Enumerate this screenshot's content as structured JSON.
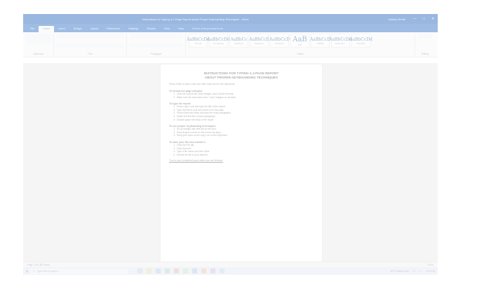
{
  "window": {
    "title": "Instructions for Typing a 2-Page Report about Proper Keyboarding Techniques - Word",
    "user": "Jessica Smith"
  },
  "menu": {
    "items": [
      "File",
      "Home",
      "Insert",
      "Design",
      "Layout",
      "References",
      "Mailings",
      "Review",
      "View",
      "Help"
    ],
    "active_index": 1,
    "tell_me": "Tell me what you want to do"
  },
  "ribbon": {
    "groups": [
      "Clipboard",
      "Font",
      "Paragraph",
      "Styles",
      "Editing"
    ],
    "styles": [
      {
        "sample": "AaBbCcDd",
        "name": "Normal"
      },
      {
        "sample": "AaBbCcDd",
        "name": "No Spacing"
      },
      {
        "sample": "AaBbCc",
        "name": "Heading 1"
      },
      {
        "sample": "AaBbCcE",
        "name": "Heading 2"
      },
      {
        "sample": "AaBbCcD",
        "name": "Heading 3"
      },
      {
        "sample": "AaB",
        "name": "Title"
      },
      {
        "sample": "AaBbCcD",
        "name": "Subtitle"
      },
      {
        "sample": "AaBbCcDd",
        "name": "Subtle Em..."
      },
      {
        "sample": "AaBbCcDd",
        "name": "Emphasis"
      }
    ]
  },
  "document": {
    "title_line1": "INSTRUCTIONS FOR TYPING A 2-PAGE REPORT",
    "title_line2": "ABOUT PROPER KEYBOARDING TECHNIQUES",
    "intro": "Press Enter to start a new line after each item in the directions.",
    "sections": [
      {
        "heading": "To format the page margins:",
        "items": [
          "Click the Layout tab, click Margins, and choose Normal.",
          "Make sure the document uses 1-inch margins on all sides."
        ]
      },
      {
        "heading": "To type the report:",
        "items": [
          "Press Caps Lock and type the title of the report.",
          "Type the title in bold and center it on the page.",
          "Press Enter two times and type the body paragraphs.",
          "Indent the first line of each paragraph.",
          "Double space the body of the report."
        ]
      },
      {
        "heading": "To use proper keyboarding techniques:",
        "items": [
          "Sit up straight with feet flat on the floor.",
          "Keep fingers curved on the home row keys.",
          "Keep your eyes on the copy, not on the keyboard."
        ]
      },
      {
        "heading": "To save your file and submit it:",
        "items": [
          "Click the File tab.",
          "Click Save As.",
          "Type a file name and click Save.",
          "Submit the file to your teacher."
        ]
      }
    ],
    "closing": "Turn in your completed report when you are finished."
  },
  "status": {
    "left": "Page 1 of 2    387 words",
    "right": "100%"
  },
  "taskbar": {
    "search_placeholder": "Type here to search",
    "weather": "60°F Mostly clear",
    "time": "4:15 PM"
  }
}
